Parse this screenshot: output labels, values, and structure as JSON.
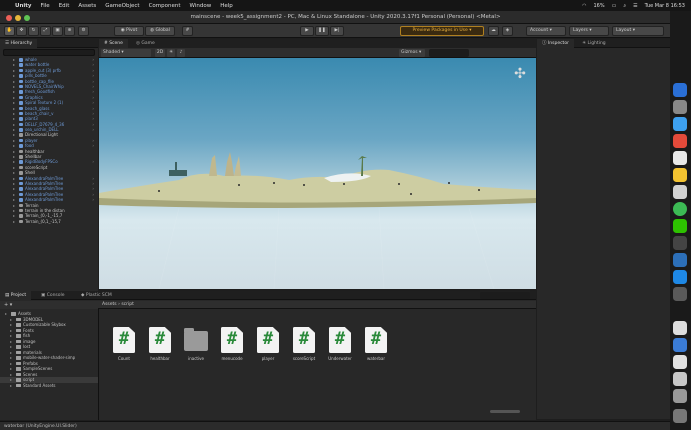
{
  "menubar": {
    "app_name": "Unity",
    "items": [
      "File",
      "Edit",
      "Assets",
      "GameObject",
      "Component",
      "Window",
      "Help"
    ],
    "battery": "16%",
    "clock": "Tue Mar 8 16:53"
  },
  "window": {
    "title": "mainscene - week5_assignment2 - PC, Mac & Linux Standalone - Unity 2020.3.17f1 Personal (Personal) <Metal>"
  },
  "toolbar": {
    "pivot_label": "Pivot",
    "global_label": "Global",
    "preview_packages": "Preview Packages in Use",
    "account_label": "Account",
    "layers_label": "Layers",
    "layout_label": "Layout"
  },
  "hierarchy": {
    "tab_label": "Hierarchy",
    "items": [
      {
        "name": "whale",
        "blue": true
      },
      {
        "name": "water bottle",
        "blue": true
      },
      {
        "name": "apple_cut (3) prfb",
        "blue": true
      },
      {
        "name": "pills_bottle",
        "blue": true
      },
      {
        "name": "bottle_cap_file",
        "blue": true
      },
      {
        "name": "NOVELS_ChairWhip",
        "blue": true
      },
      {
        "name": "fresh_Goodfish",
        "blue": true
      },
      {
        "name": "Graphics",
        "blue": true
      },
      {
        "name": "Spiral Texture 2 (1)",
        "blue": true
      },
      {
        "name": "beach_glass",
        "blue": true
      },
      {
        "name": "beach_chair_v",
        "blue": true
      },
      {
        "name": "plant3",
        "blue": true
      },
      {
        "name": "DELLF_D7679_4_36",
        "blue": true
      },
      {
        "name": "sea_urchin_DELL",
        "blue": true
      },
      {
        "name": "Directional Light",
        "blue": false
      },
      {
        "name": "player",
        "blue": true
      },
      {
        "name": "food",
        "blue": true
      },
      {
        "name": "healthbar",
        "blue": false
      },
      {
        "name": "Shellbar",
        "blue": false
      },
      {
        "name": "RigidBodyFPSCo",
        "blue": true
      },
      {
        "name": "scoreScript",
        "blue": false
      },
      {
        "name": "Shell",
        "blue": false
      },
      {
        "name": "AlexandraPalmTree",
        "blue": true
      },
      {
        "name": "AlexandraPalmTree",
        "blue": true
      },
      {
        "name": "AlexandraPalmTree",
        "blue": true
      },
      {
        "name": "AlexandraPalmTree",
        "blue": true
      },
      {
        "name": "AlexandraPalmTree",
        "blue": true
      },
      {
        "name": "Terrain",
        "blue": false
      },
      {
        "name": "terrain in the distan",
        "blue": false
      },
      {
        "name": "Terrain_(0,-1_-15,7",
        "blue": false
      },
      {
        "name": "Terrain_(0,1_-15,7",
        "blue": false
      }
    ]
  },
  "scene": {
    "tabs": [
      "Scene",
      "Game"
    ],
    "shading_mode": "Shaded",
    "gizmos_label": "Gizmos"
  },
  "inspector": {
    "tabs": [
      "Inspector",
      "Lighting"
    ]
  },
  "project": {
    "tabs": [
      "Project",
      "Console",
      "Plastic SCM"
    ],
    "breadcrumb": [
      "Assets",
      "script"
    ],
    "tree": [
      {
        "name": "Assets",
        "level": 0
      },
      {
        "name": "3DMODEL",
        "level": 1
      },
      {
        "name": "Customizable Skybox",
        "level": 1
      },
      {
        "name": "Fonts",
        "level": 1
      },
      {
        "name": "fish",
        "level": 1
      },
      {
        "name": "image",
        "level": 1
      },
      {
        "name": "lost",
        "level": 1
      },
      {
        "name": "materials",
        "level": 1
      },
      {
        "name": "mobile-water-shader-simp",
        "level": 1
      },
      {
        "name": "Prefabs",
        "level": 1
      },
      {
        "name": "SampleScenes",
        "level": 1
      },
      {
        "name": "Scenes",
        "level": 1
      },
      {
        "name": "script",
        "level": 1
      },
      {
        "name": "Standard Assets",
        "level": 1
      }
    ],
    "assets": [
      {
        "label": "Count",
        "kind": "script"
      },
      {
        "label": "healthbar",
        "kind": "script"
      },
      {
        "label": "inactive",
        "kind": "folder"
      },
      {
        "label": "menucode",
        "kind": "script"
      },
      {
        "label": "player",
        "kind": "script"
      },
      {
        "label": "scoreScript",
        "kind": "script"
      },
      {
        "label": "Underwater",
        "kind": "script"
      },
      {
        "label": "waterbar",
        "kind": "script"
      }
    ]
  },
  "status": {
    "message": "waterbar (UnityEngine.UI.Slider)"
  },
  "colors": {
    "script_icon": "#2a8a3a",
    "hierarchy_prefab": "#6e9ad6",
    "preview_packages": "#e8b040"
  }
}
